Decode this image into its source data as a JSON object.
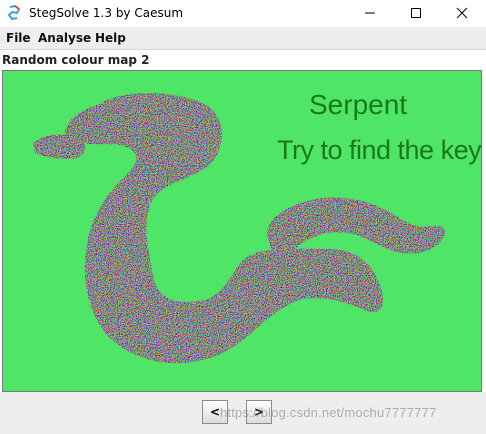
{
  "window": {
    "title": "StegSolve 1.3 by Caesum",
    "controls": [
      "minimize-icon",
      "maximize-icon",
      "close-icon"
    ]
  },
  "menu": {
    "items": [
      "File",
      "Analyse",
      "Help"
    ]
  },
  "panel": {
    "label": "Random colour map 2"
  },
  "image": {
    "heading": "Serpent",
    "subheading": "Try to find the key",
    "background_color": "#4fe566",
    "text_color": "#1a7a1a"
  },
  "navigation": {
    "prev_label": "<",
    "next_label": ">"
  },
  "watermark": "https://blog.csdn.net/mochu7777777"
}
